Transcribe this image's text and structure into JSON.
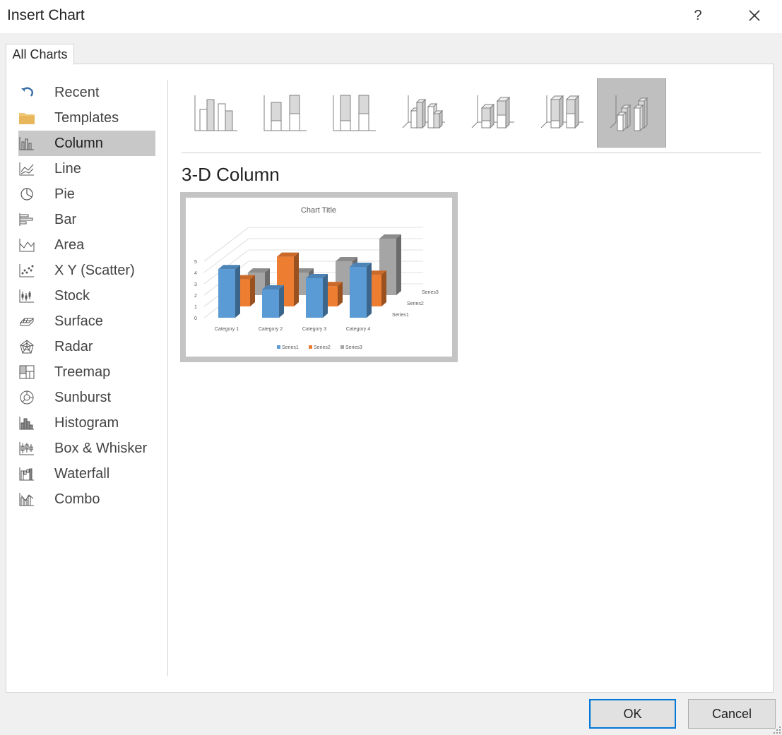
{
  "dialog": {
    "title": "Insert Chart",
    "help": "?"
  },
  "tab": {
    "label": "All Charts"
  },
  "sidebar": {
    "items": [
      {
        "label": "Recent",
        "icon": "recent-icon"
      },
      {
        "label": "Templates",
        "icon": "folder-icon"
      },
      {
        "label": "Column",
        "icon": "column-chart-icon",
        "selected": true
      },
      {
        "label": "Line",
        "icon": "line-chart-icon"
      },
      {
        "label": "Pie",
        "icon": "pie-chart-icon"
      },
      {
        "label": "Bar",
        "icon": "bar-chart-icon"
      },
      {
        "label": "Area",
        "icon": "area-chart-icon"
      },
      {
        "label": "X Y (Scatter)",
        "icon": "scatter-chart-icon"
      },
      {
        "label": "Stock",
        "icon": "stock-chart-icon"
      },
      {
        "label": "Surface",
        "icon": "surface-chart-icon"
      },
      {
        "label": "Radar",
        "icon": "radar-chart-icon"
      },
      {
        "label": "Treemap",
        "icon": "treemap-chart-icon"
      },
      {
        "label": "Sunburst",
        "icon": "sunburst-chart-icon"
      },
      {
        "label": "Histogram",
        "icon": "histogram-chart-icon"
      },
      {
        "label": "Box & Whisker",
        "icon": "box-whisker-chart-icon"
      },
      {
        "label": "Waterfall",
        "icon": "waterfall-chart-icon"
      },
      {
        "label": "Combo",
        "icon": "combo-chart-icon"
      }
    ]
  },
  "subtypes": [
    {
      "icon": "clustered-column-icon"
    },
    {
      "icon": "stacked-column-icon"
    },
    {
      "icon": "100-stacked-column-icon"
    },
    {
      "icon": "3d-clustered-column-icon"
    },
    {
      "icon": "3d-stacked-column-icon"
    },
    {
      "icon": "3d-100-stacked-column-icon"
    },
    {
      "icon": "3d-column-icon",
      "selected": true
    }
  ],
  "selected_type": {
    "heading": "3-D Column"
  },
  "preview": {
    "chart_data": {
      "type": "bar",
      "title": "Chart Title",
      "categories": [
        "Category 1",
        "Category 2",
        "Category 3",
        "Category 4"
      ],
      "depth_labels": [
        "Series3",
        "Series2",
        "Series1"
      ],
      "y_ticks": [
        "0",
        "1",
        "2",
        "3",
        "4",
        "5"
      ],
      "ylim": [
        0,
        5
      ],
      "series": [
        {
          "name": "Series1",
          "values": [
            4.3,
            2.5,
            3.5,
            4.5
          ],
          "color": "#5b9bd5"
        },
        {
          "name": "Series2",
          "values": [
            2.4,
            4.4,
            1.8,
            2.8
          ],
          "color": "#ed7d31"
        },
        {
          "name": "Series3",
          "values": [
            2,
            2,
            3,
            5
          ],
          "color": "#a5a5a5"
        }
      ],
      "legend_position": "bottom",
      "gridlines": true
    }
  },
  "buttons": {
    "ok": "OK",
    "cancel": "Cancel"
  }
}
